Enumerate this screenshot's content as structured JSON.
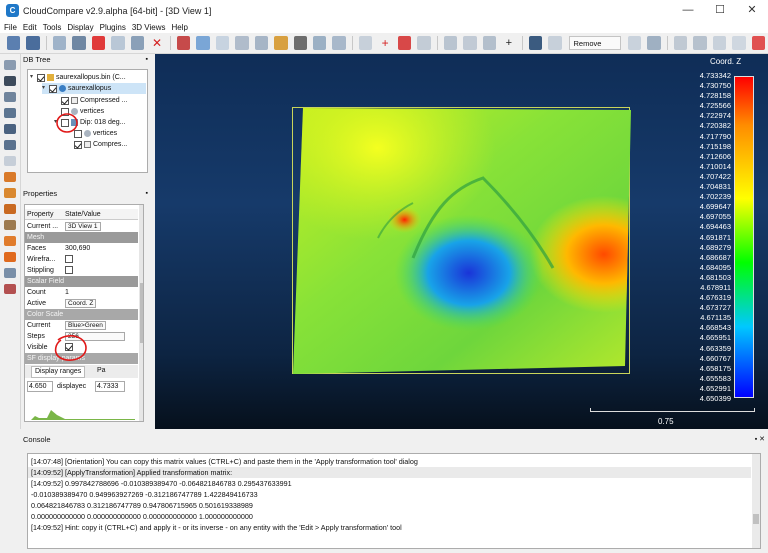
{
  "window": {
    "title": "CloudCompare v2.9.alpha [64-bit] - [3D View 1]",
    "minimize": "—",
    "maximize": "☐",
    "close": "✕"
  },
  "menu": [
    "File",
    "Edit",
    "Tools",
    "Display",
    "Plugins",
    "3D Views",
    "Help"
  ],
  "toolbar": {
    "remove_filter": "Remove filter"
  },
  "db_tree": {
    "header": "DB Tree",
    "items": [
      {
        "label": "saurexallopus.bin (C..."
      },
      {
        "label": "saurexallopus"
      },
      {
        "label": "Compressed ..."
      },
      {
        "label": "vertices"
      },
      {
        "label": "Dip: 018 deg..."
      },
      {
        "label": "vertices"
      },
      {
        "label": "Compres..."
      }
    ]
  },
  "properties": {
    "header": "Properties",
    "col_property": "Property",
    "col_value": "State/Value",
    "rows": {
      "current_display_k": "Current ...",
      "current_display_v": "3D View 1",
      "mesh": "Mesh",
      "faces_k": "Faces",
      "faces_v": "300,690",
      "wireframe_k": "Wirefra...",
      "stippling_k": "Stippling",
      "scalar_field": "Scalar Field",
      "count_k": "Count",
      "count_v": "1",
      "active_k": "Active",
      "active_v": "Coord. Z",
      "color_scale": "Color Scale",
      "current_k": "Current",
      "current_v": "Blue>Green",
      "steps_k": "Steps",
      "steps_v": "256",
      "visible_k": "Visible",
      "sf_display": "SF display params",
      "tab_display_ranges": "Display ranges",
      "tab_pa": "Pa",
      "range_min": "4.650",
      "range_label": "displayec",
      "range_max": "4.7333"
    }
  },
  "view": {
    "colorbar_title": "Coord. Z",
    "scale_value": "0.75",
    "ticks": [
      "4.733342",
      "4.730750",
      "4.728158",
      "4.725566",
      "4.722974",
      "4.720382",
      "4.717790",
      "4.715198",
      "4.712606",
      "4.710014",
      "4.707422",
      "4.704831",
      "4.702239",
      "4.699647",
      "4.697055",
      "4.694463",
      "4.691871",
      "4.689279",
      "4.686687",
      "4.684095",
      "4.681503",
      "4.678911",
      "4.676319",
      "4.673727",
      "4.671135",
      "4.668543",
      "4.665951",
      "4.663359",
      "4.660767",
      "4.658175",
      "4.655583",
      "4.652991",
      "4.650399"
    ]
  },
  "console": {
    "header": "Console",
    "lines": [
      "[14:07:48] [Orientation] You can copy this matrix values (CTRL+C) and paste them in the 'Apply transformation tool' dialog",
      "[14:09:52] [ApplyTransformation] Applied transformation matrix:",
      "[14:09:52] 0.997842788696 -0.010389389470 -0.064821846783 0.295437633991",
      "-0.010389389470 0.949963927269 -0.312186747789 1.422849416733",
      "0.064821846783 0.312186747789 0.947806715965 0.501619338989",
      "0.000000000000 0.000000000000 0.000000000000 1.000000000000",
      "[14:09:52] Hint: copy it (CTRL+C) and apply it - or its inverse - on any entity with the 'Edit > Apply transformation' tool"
    ]
  }
}
